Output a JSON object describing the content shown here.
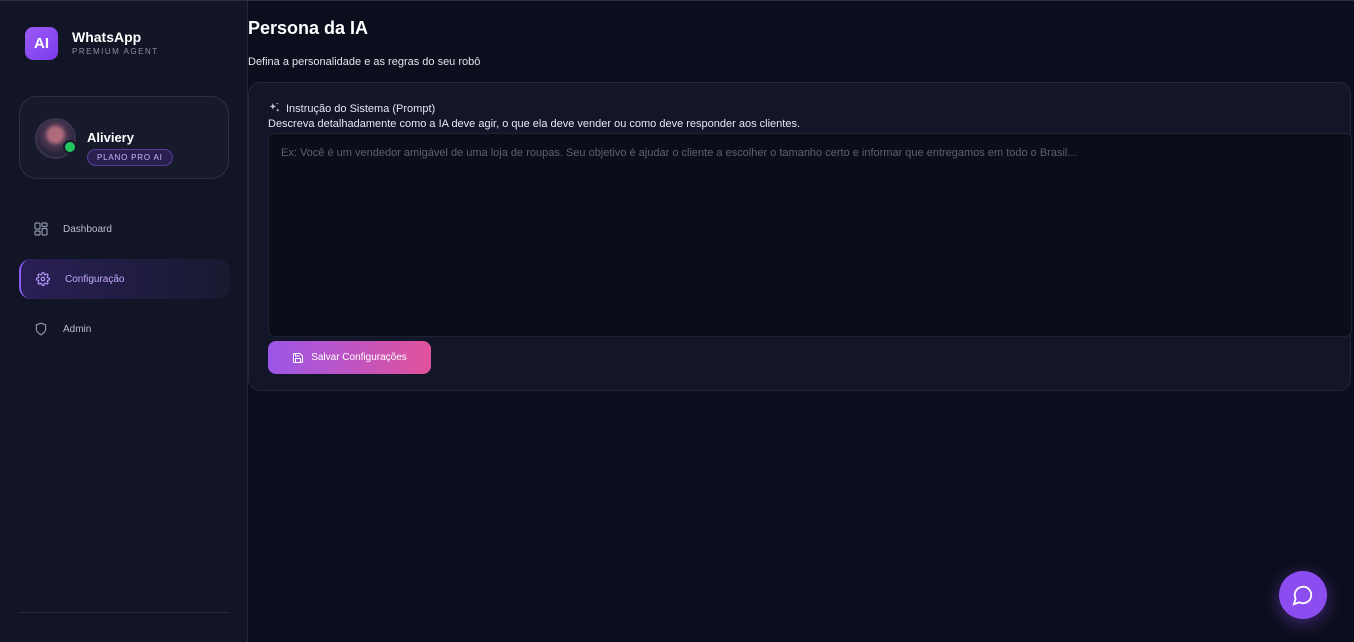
{
  "brand": {
    "logo_text": "AI",
    "title": "WhatsApp",
    "subtitle": "PREMIUM AGENT"
  },
  "user": {
    "name": "Aliviery",
    "plan": "PLANO PRO AI",
    "status_color": "#22c55e"
  },
  "nav": {
    "items": [
      {
        "label": "Dashboard",
        "icon": "dashboard-grid-icon",
        "active": false
      },
      {
        "label": "Configuração",
        "icon": "gear-icon",
        "active": true
      },
      {
        "label": "Admin",
        "icon": "shield-icon",
        "active": false
      }
    ]
  },
  "page": {
    "title": "Persona da IA",
    "subtitle": "Defina a personalidade e as regras do seu robô"
  },
  "prompt": {
    "label": "Instrução do Sistema (Prompt)",
    "description": "Descreva detalhadamente como a IA deve agir, o que ela deve vender ou como deve responder aos clientes.",
    "value": "",
    "placeholder": "Ex: Você é um vendedor amigável de uma loja de roupas. Seu objetivo é ajudar o cliente a escolher o tamanho certo e informar que entregamos em todo o Brasil..."
  },
  "actions": {
    "save_label": "Salvar Configurações"
  },
  "colors": {
    "accent": "#8b5cf6",
    "button_gradient_start": "#9b57e8",
    "button_gradient_end": "#e2529c",
    "background": "#0b0e1c"
  }
}
